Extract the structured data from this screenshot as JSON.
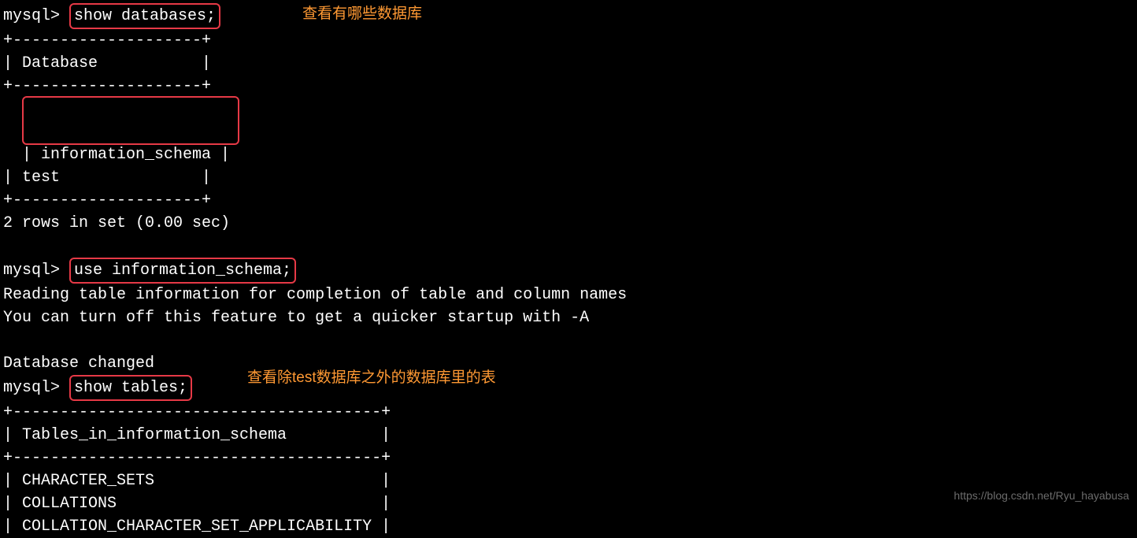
{
  "prompt": "mysql> ",
  "cmd1": "show databases;",
  "annot1": "查看有哪些数据库",
  "sep1": "+--------------------+",
  "header1": "| Database           |",
  "rows1_line1": "| information_schema |",
  "rows1_line2": "| test               |",
  "result1": "2 rows in set (0.00 sec)",
  "cmd2": "use information_schema;",
  "msg2a": "Reading table information for completion of table and column names",
  "msg2b": "You can turn off this feature to get a quicker startup with -A",
  "msg2c": "Database changed",
  "cmd3": "show tables;",
  "annot3": "查看除test数据库之外的数据库里的表",
  "sep3": "+---------------------------------------+",
  "header3": "| Tables_in_information_schema          |",
  "row3a": "| CHARACTER_SETS                        |",
  "row3b": "| COLLATIONS                            |",
  "row3c": "| COLLATION_CHARACTER_SET_APPLICABILITY |",
  "watermark": "https://blog.csdn.net/Ryu_hayabusa"
}
